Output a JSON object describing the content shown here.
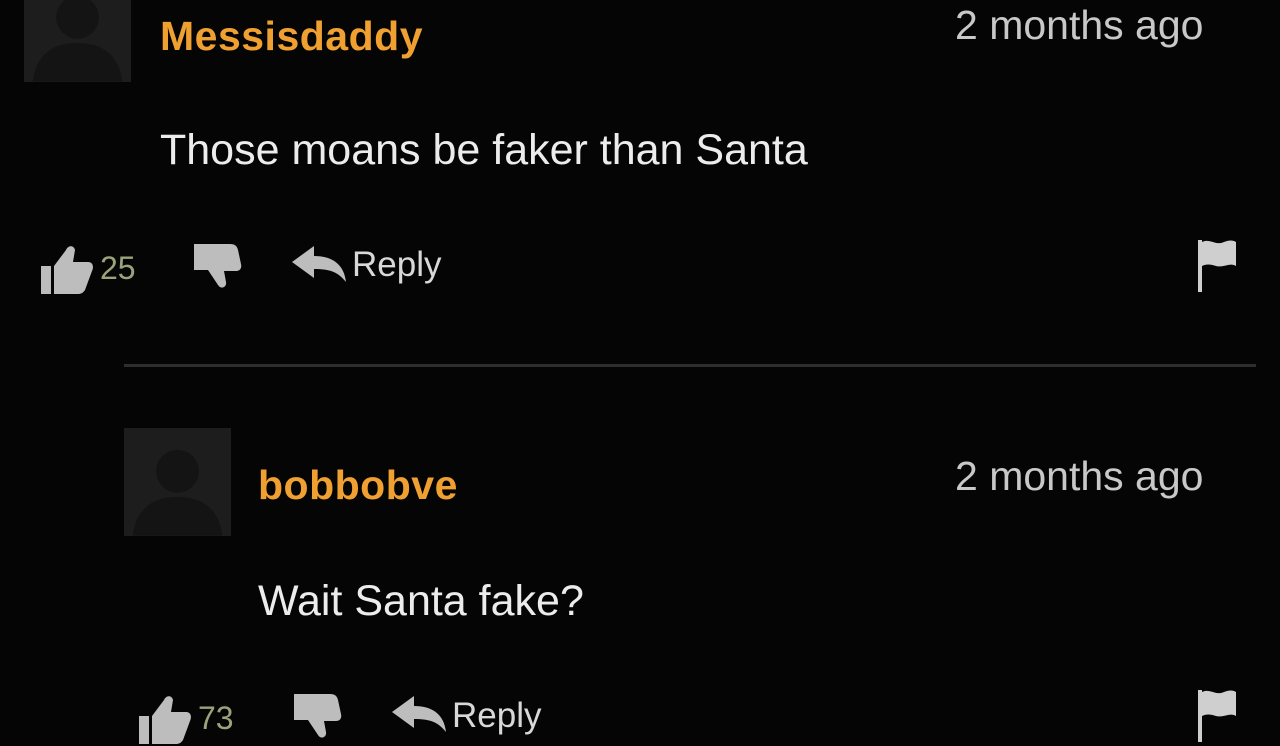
{
  "comments": [
    {
      "username": "Messisdaddy",
      "timestamp": "2 months ago",
      "text": "Those moans be faker than Santa",
      "likes": "25",
      "reply_label": "Reply"
    },
    {
      "username": "bobbobve",
      "timestamp": "2 months ago",
      "text": "Wait Santa fake?",
      "likes": "73",
      "reply_label": "Reply"
    }
  ],
  "colors": {
    "background": "#050505",
    "username": "#f0a030",
    "text": "#ececec",
    "like_count": "#9aa37a"
  },
  "icons": [
    "avatar-silhouette-icon",
    "thumbs-up-icon",
    "thumbs-down-icon",
    "reply-arrow-icon",
    "flag-icon"
  ]
}
